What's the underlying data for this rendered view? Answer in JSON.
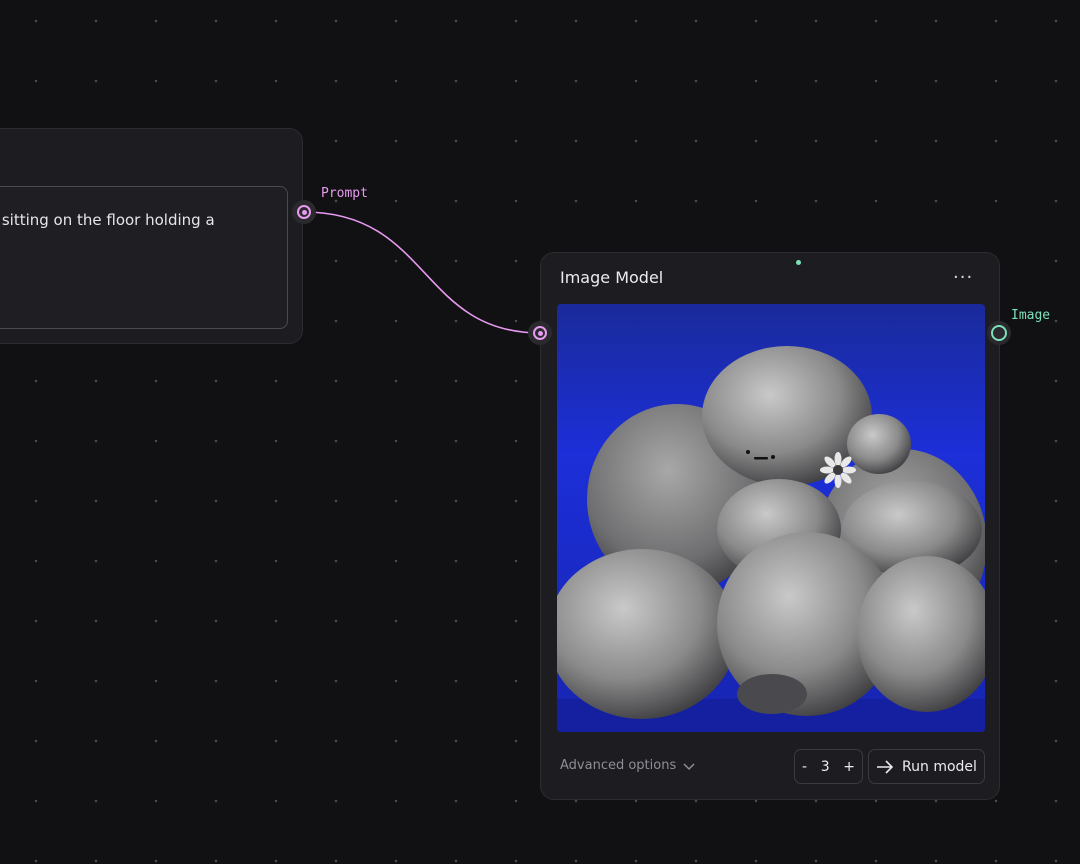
{
  "prompt_node": {
    "text": "re sitting on the floor holding a",
    "output_port_label": "Prompt"
  },
  "image_node": {
    "title": "Image Model",
    "menu_label": "···",
    "output_port_label": "Image",
    "image_alt": "Rendered image of a pile of soft grey blob figures holding a small white flower against a blue background",
    "advanced_label": "Advanced options",
    "stepper": {
      "minus": "-",
      "value": "3",
      "plus": "+"
    },
    "run_label": "Run model"
  },
  "colors": {
    "background": "#111113",
    "node": "#1d1d21",
    "prompt_accent": "#e79af0",
    "image_accent": "#7ee0b8"
  },
  "icons": {
    "menu": "more-horizontal-icon",
    "advanced": "chevron-down-icon",
    "run": "arrow-right-icon"
  }
}
